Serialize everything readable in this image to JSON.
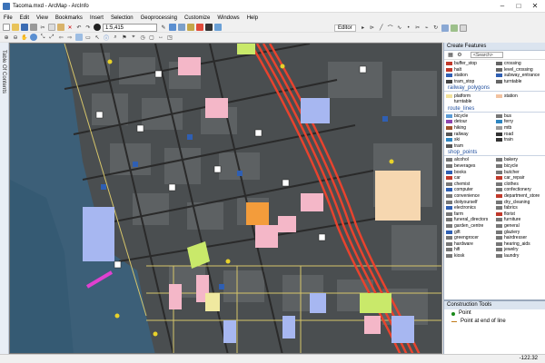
{
  "window": {
    "title": "Tacoma.mxd - ArcMap - ArcInfo",
    "minimize": "–",
    "maximize": "□",
    "close": "✕"
  },
  "menu": [
    "File",
    "Edit",
    "View",
    "Bookmarks",
    "Insert",
    "Selection",
    "Geoprocessing",
    "Customize",
    "Windows",
    "Help"
  ],
  "toolbar": {
    "scale": "1:5,415",
    "editor_label": "Editor"
  },
  "toc_tab": "Table Of Contents",
  "panel": {
    "title": "Create Features",
    "search_placeholder": "<Search>",
    "groups": [
      {
        "name": "",
        "items": [
          {
            "label": "buffer_stop",
            "color": "#c0392b"
          },
          {
            "label": "crossing",
            "color": "#666666"
          },
          {
            "label": "halt",
            "color": "#c0392b"
          },
          {
            "label": "level_crossing",
            "color": "#666666"
          },
          {
            "label": "station",
            "color": "#2f5fb3"
          },
          {
            "label": "subway_entrance",
            "color": "#2f5fb3"
          },
          {
            "label": "tram_stop",
            "color": "#444444"
          },
          {
            "label": "turntable",
            "color": "#666666"
          }
        ]
      },
      {
        "name": "railway_polygons",
        "items": [
          {
            "label": "platform",
            "color": "#f3e29b"
          },
          {
            "label": "station",
            "color": "#f2c2a0"
          },
          {
            "label": "turntable",
            "color": "#ffffff"
          }
        ]
      },
      {
        "name": "route_lines",
        "items": [
          {
            "label": "bicycle",
            "color": "#5a9bd5"
          },
          {
            "label": "bus",
            "color": "#777777"
          },
          {
            "label": "detour",
            "color": "#8e44ad"
          },
          {
            "label": "ferry",
            "color": "#2e86c1"
          },
          {
            "label": "hiking",
            "color": "#a0522d"
          },
          {
            "label": "mtb",
            "color": "#999999"
          },
          {
            "label": "railway",
            "color": "#555555"
          },
          {
            "label": "road",
            "color": "#333333"
          },
          {
            "label": "ski",
            "color": "#2e86c1"
          },
          {
            "label": "train",
            "color": "#333333"
          },
          {
            "label": "tram",
            "color": "#555555"
          }
        ]
      },
      {
        "name": "shop_points",
        "items": [
          {
            "label": "alcohol",
            "color": "#777777"
          },
          {
            "label": "bakery",
            "color": "#777777"
          },
          {
            "label": "beverages",
            "color": "#777777"
          },
          {
            "label": "bicycle",
            "color": "#777777"
          },
          {
            "label": "books",
            "color": "#2f5fb3"
          },
          {
            "label": "butcher",
            "color": "#777777"
          },
          {
            "label": "car",
            "color": "#c0392b"
          },
          {
            "label": "car_repair",
            "color": "#c0392b"
          },
          {
            "label": "chemist",
            "color": "#777777"
          },
          {
            "label": "clothes",
            "color": "#777777"
          },
          {
            "label": "computer",
            "color": "#2f5fb3"
          },
          {
            "label": "confectionery",
            "color": "#777777"
          },
          {
            "label": "convenience",
            "color": "#777777"
          },
          {
            "label": "department_store",
            "color": "#c0392b"
          },
          {
            "label": "doityourself",
            "color": "#777777"
          },
          {
            "label": "dry_cleaning",
            "color": "#777777"
          },
          {
            "label": "electronics",
            "color": "#2f5fb3"
          },
          {
            "label": "fabrics",
            "color": "#777777"
          },
          {
            "label": "farm",
            "color": "#777777"
          },
          {
            "label": "florist",
            "color": "#c0392b"
          },
          {
            "label": "funeral_directors",
            "color": "#777777"
          },
          {
            "label": "furniture",
            "color": "#777777"
          },
          {
            "label": "garden_centre",
            "color": "#777777"
          },
          {
            "label": "general",
            "color": "#777777"
          },
          {
            "label": "gift",
            "color": "#2f5fb3"
          },
          {
            "label": "glaziery",
            "color": "#777777"
          },
          {
            "label": "greengrocer",
            "color": "#777777"
          },
          {
            "label": "hairdresser",
            "color": "#777777"
          },
          {
            "label": "hardware",
            "color": "#777777"
          },
          {
            "label": "hearing_aids",
            "color": "#777777"
          },
          {
            "label": "hifi",
            "color": "#777777"
          },
          {
            "label": "jewelry",
            "color": "#777777"
          },
          {
            "label": "kiosk",
            "color": "#777777"
          },
          {
            "label": "laundry",
            "color": "#777777"
          }
        ]
      }
    ]
  },
  "construction": {
    "title": "Construction Tools",
    "items": [
      "Point",
      "Point at end of line"
    ]
  },
  "status": {
    "coords": "-122.32"
  }
}
